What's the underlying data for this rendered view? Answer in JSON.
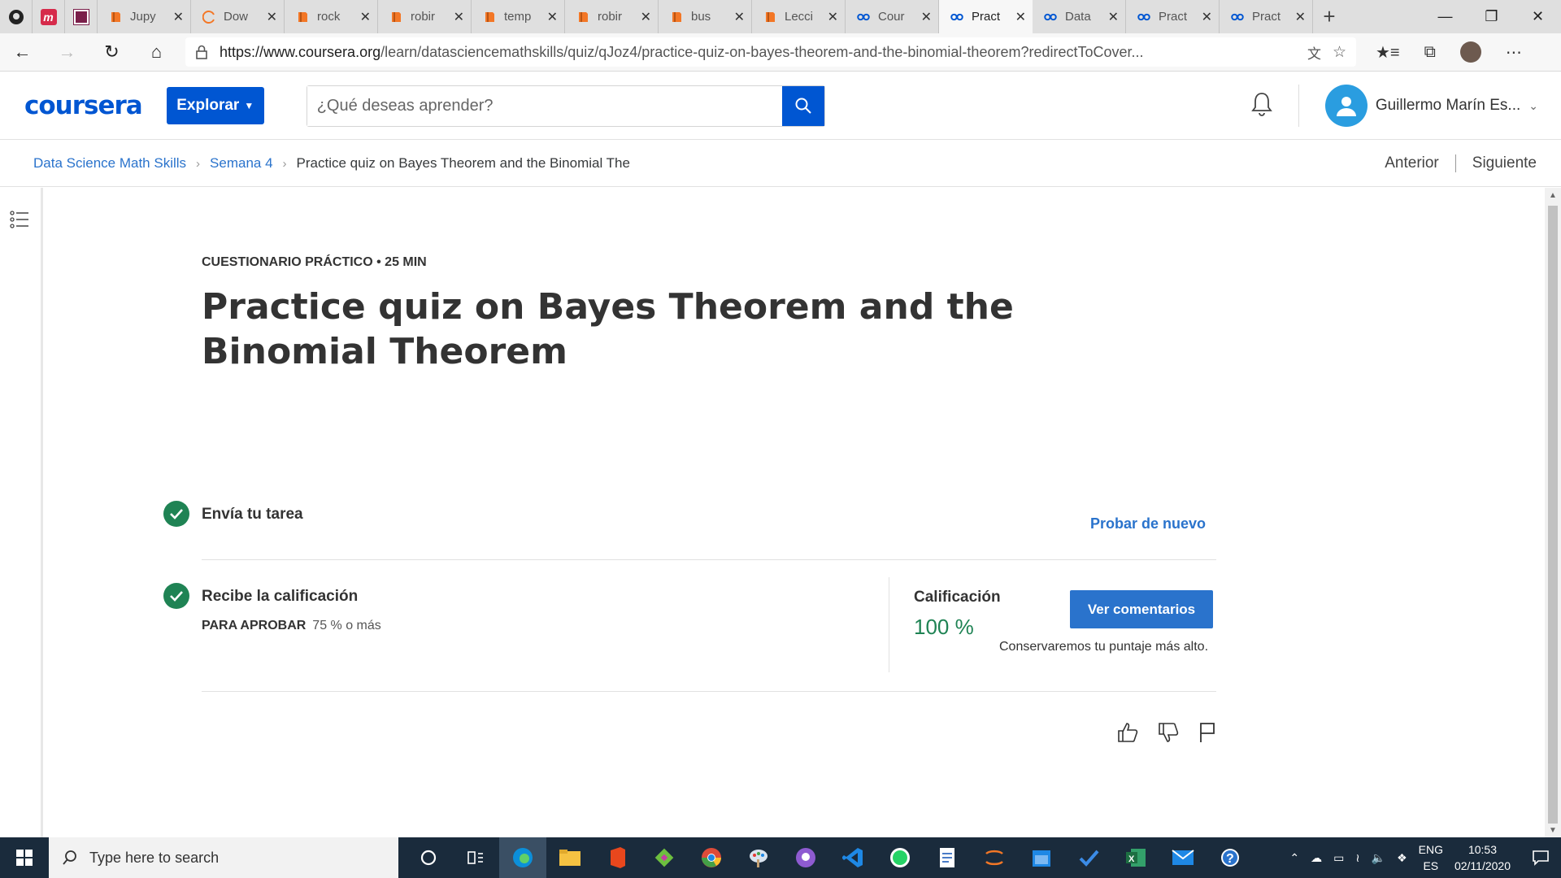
{
  "browser": {
    "tabs": [
      {
        "title": "Jupy",
        "icon": "jupyter-icon",
        "color": "#f37726"
      },
      {
        "title": "Dow",
        "icon": "anaconda-icon",
        "color": "#43b049"
      },
      {
        "title": "rock",
        "icon": "jupyter-icon",
        "color": "#f37726"
      },
      {
        "title": "robir",
        "icon": "jupyter-icon",
        "color": "#f37726"
      },
      {
        "title": "temp",
        "icon": "jupyter-icon",
        "color": "#f37726"
      },
      {
        "title": "robir",
        "icon": "jupyter-icon",
        "color": "#f37726"
      },
      {
        "title": "bus",
        "icon": "jupyter-icon",
        "color": "#f37726"
      },
      {
        "title": "Lecci",
        "icon": "jupyter-icon",
        "color": "#f37726"
      },
      {
        "title": "Cour",
        "icon": "coursera-icon",
        "color": "#0056d2"
      },
      {
        "title": "Pract",
        "icon": "coursera-icon",
        "color": "#0056d2",
        "active": true
      },
      {
        "title": "Data",
        "icon": "coursera-icon",
        "color": "#0056d2"
      },
      {
        "title": "Pract",
        "icon": "coursera-icon",
        "color": "#0056d2"
      },
      {
        "title": "Pract",
        "icon": "coursera-icon",
        "color": "#0056d2"
      }
    ],
    "url_host": "https://www.coursera.org",
    "url_path": "/learn/datasciencemathskills/quiz/qJoz4/practice-quiz-on-bayes-theorem-and-the-binomial-theorem?redirectToCover..."
  },
  "header": {
    "logo": "coursera",
    "explore_label": "Explorar",
    "search_placeholder": "¿Qué deseas aprender?",
    "user_name": "Guillermo Marín Es...",
    "brand_color": "#0056d2"
  },
  "breadcrumb": {
    "course": "Data Science Math Skills",
    "week": "Semana 4",
    "current": "Practice quiz on Bayes Theorem and the Binomial The",
    "prev": "Anterior",
    "next": "Siguiente"
  },
  "quiz": {
    "kicker": "CUESTIONARIO PRÁCTICO • 25 MIN",
    "title": "Practice quiz on Bayes Theorem and the Binomial Theorem",
    "step1": "Envía tu tarea",
    "retry": "Probar de nuevo",
    "step2": "Recibe la calificación",
    "pass_label": "PARA APROBAR",
    "pass_value": "75 % o más",
    "grade_label": "Calificación",
    "grade_value": "100 %",
    "view_feedback": "Ver comentarios",
    "keep_note": "Conservaremos tu puntaje más alto.",
    "success_color": "#1f8354"
  },
  "taskbar": {
    "search_placeholder": "Type here to search",
    "lang_top": "ENG",
    "lang_bottom": "ES",
    "time": "10:53",
    "date": "02/11/2020"
  }
}
